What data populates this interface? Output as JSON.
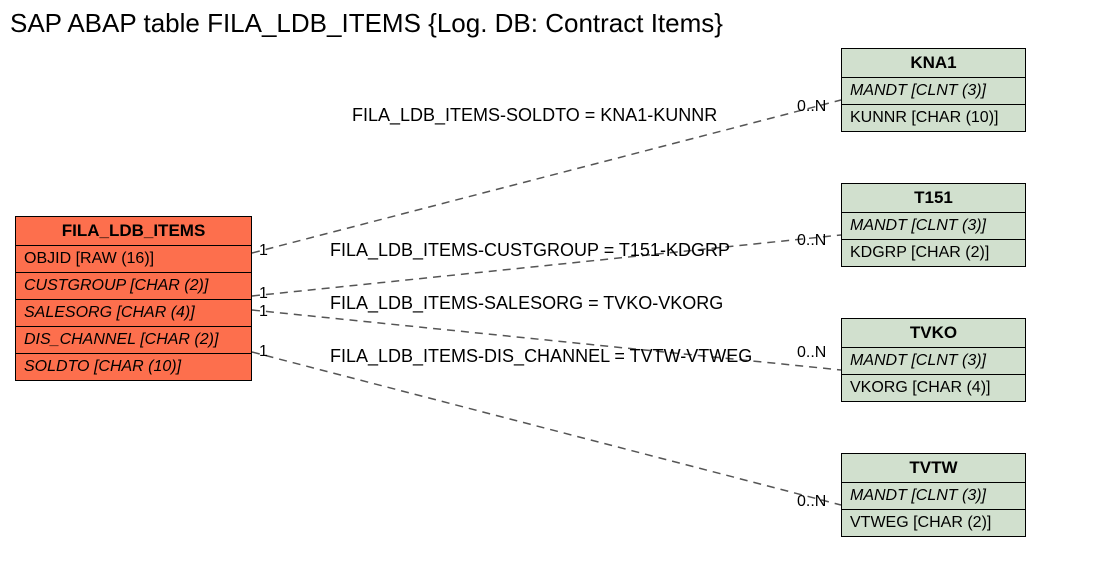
{
  "title": "SAP ABAP table FILA_LDB_ITEMS {Log. DB: Contract Items}",
  "mainEntity": {
    "name": "FILA_LDB_ITEMS",
    "fields": [
      {
        "label": "OBJID [RAW (16)]",
        "italic": false
      },
      {
        "label": "CUSTGROUP [CHAR (2)]",
        "italic": true
      },
      {
        "label": "SALESORG [CHAR (4)]",
        "italic": true
      },
      {
        "label": "DIS_CHANNEL [CHAR (2)]",
        "italic": true
      },
      {
        "label": "SOLDTO [CHAR (10)]",
        "italic": true
      }
    ]
  },
  "relations": [
    {
      "label": "FILA_LDB_ITEMS-SOLDTO = KNA1-KUNNR",
      "leftCard": "1",
      "rightCard": "0..N",
      "target": {
        "name": "KNA1",
        "fields": [
          {
            "label": "MANDT [CLNT (3)]",
            "italic": true
          },
          {
            "label": "KUNNR [CHAR (10)]",
            "italic": false
          }
        ]
      }
    },
    {
      "label": "FILA_LDB_ITEMS-CUSTGROUP = T151-KDGRP",
      "leftCard": "1",
      "rightCard": "0..N",
      "target": {
        "name": "T151",
        "fields": [
          {
            "label": "MANDT [CLNT (3)]",
            "italic": true
          },
          {
            "label": "KDGRP [CHAR (2)]",
            "italic": false
          }
        ]
      }
    },
    {
      "label": "FILA_LDB_ITEMS-SALESORG = TVKO-VKORG",
      "leftCard": "1",
      "rightCard": "0..N",
      "target": {
        "name": "TVKO",
        "fields": [
          {
            "label": "MANDT [CLNT (3)]",
            "italic": true
          },
          {
            "label": "VKORG [CHAR (4)]",
            "italic": false
          }
        ]
      }
    },
    {
      "label": "FILA_LDB_ITEMS-DIS_CHANNEL = TVTW-VTWEG",
      "leftCard": "1",
      "rightCard": "0..N",
      "target": {
        "name": "TVTW",
        "fields": [
          {
            "label": "MANDT [CLNT (3)]",
            "italic": true
          },
          {
            "label": "VTWEG [CHAR (2)]",
            "italic": false
          }
        ]
      }
    }
  ],
  "chart_data": {
    "type": "table",
    "description": "Entity-relationship diagram linking FILA_LDB_ITEMS to KNA1, T151, TVKO, TVTW",
    "entities": [
      "FILA_LDB_ITEMS",
      "KNA1",
      "T151",
      "TVKO",
      "TVTW"
    ],
    "relations": [
      {
        "from": "FILA_LDB_ITEMS.SOLDTO",
        "to": "KNA1.KUNNR",
        "cardinality": "1 to 0..N"
      },
      {
        "from": "FILA_LDB_ITEMS.CUSTGROUP",
        "to": "T151.KDGRP",
        "cardinality": "1 to 0..N"
      },
      {
        "from": "FILA_LDB_ITEMS.SALESORG",
        "to": "TVKO.VKORG",
        "cardinality": "1 to 0..N"
      },
      {
        "from": "FILA_LDB_ITEMS.DIS_CHANNEL",
        "to": "TVTW.VTWEG",
        "cardinality": "1 to 0..N"
      }
    ]
  }
}
